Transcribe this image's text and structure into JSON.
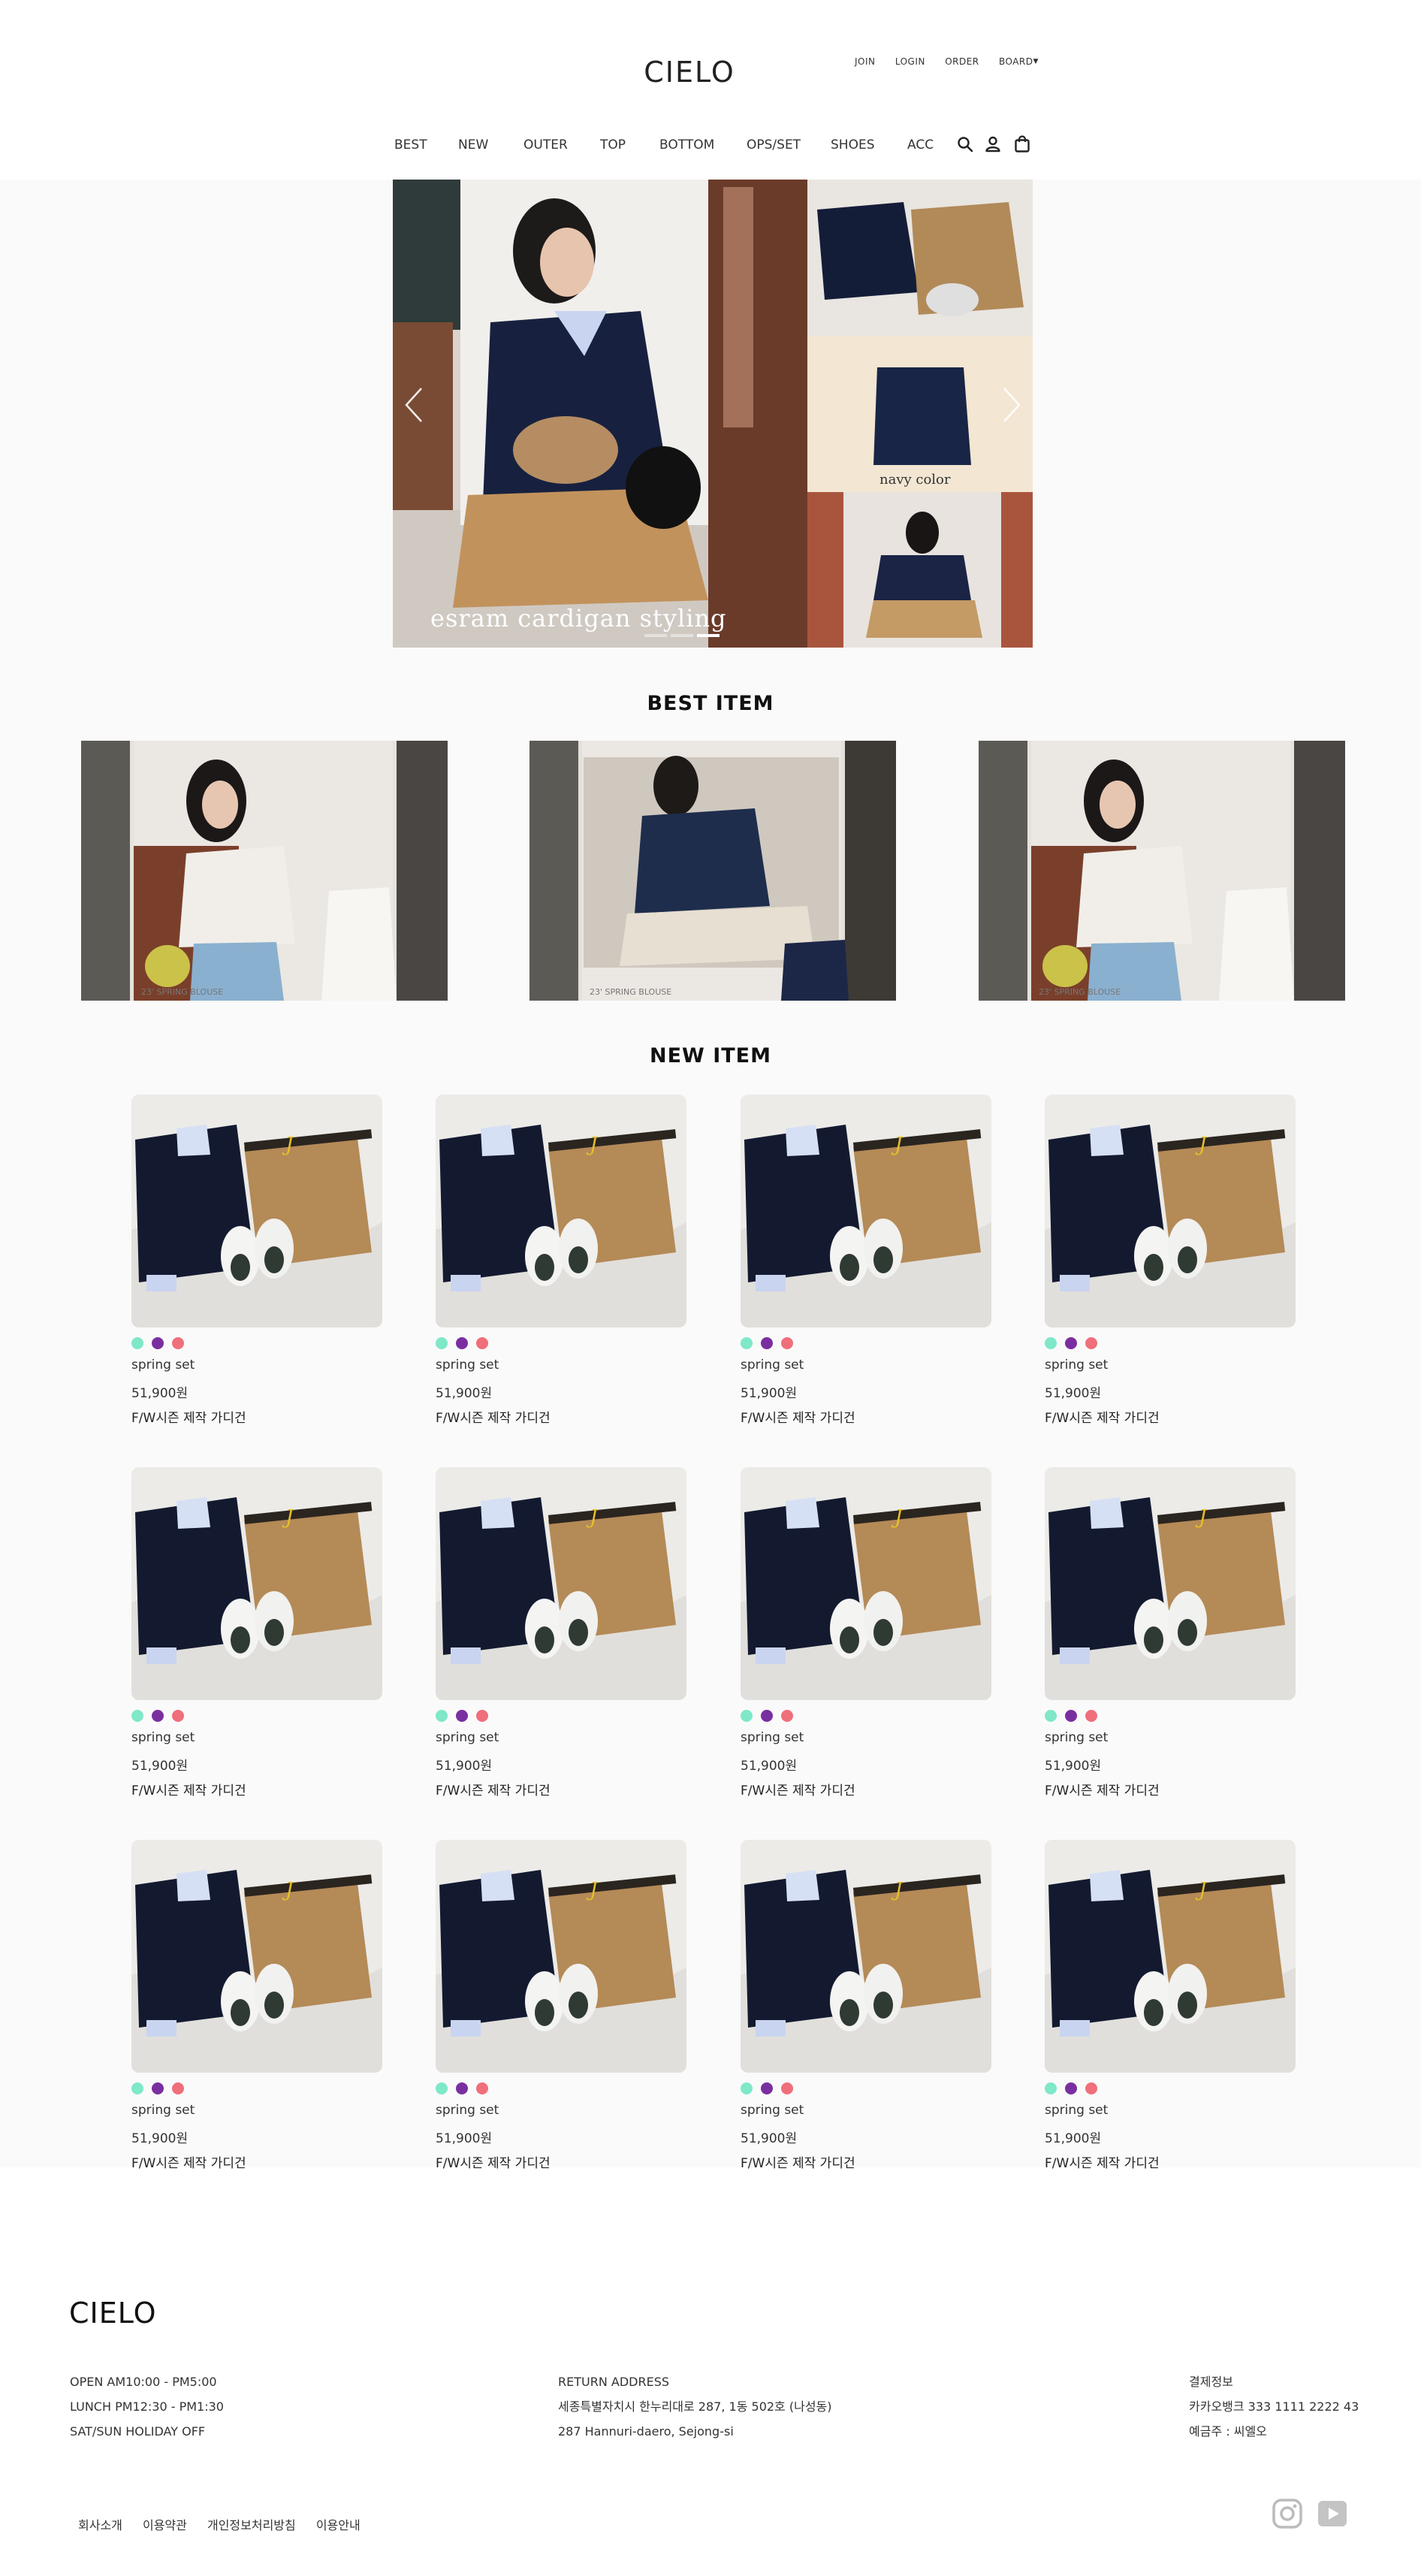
{
  "header": {
    "logo": "CIELO",
    "util_links": [
      "JOIN",
      "LOGIN",
      "ORDER",
      "BOARD"
    ]
  },
  "nav": {
    "items": [
      "BEST",
      "NEW",
      "OUTER",
      "TOP",
      "BOTTOM",
      "OPS/SET",
      "SHOES",
      "ACC"
    ],
    "icons": [
      "search-icon",
      "user-icon",
      "shopping-bag-icon"
    ]
  },
  "hero": {
    "caption": "esram cardigan styling",
    "sub_caption": "navy color",
    "slide_count": 3,
    "active_slide": 2
  },
  "best": {
    "title": "BEST ITEM",
    "items": [
      {
        "caption": "23' SPRING BLOUSE"
      },
      {
        "caption": "23' SPRING BLOUSE"
      },
      {
        "caption": "23' SPRING BLOUSE"
      }
    ]
  },
  "new": {
    "title": "NEW ITEM",
    "swatch_colors": [
      "#7ee8c8",
      "#7a2fa0",
      "#ef6f7a"
    ],
    "items": [
      {
        "name": "spring set",
        "price": "51,900원",
        "desc": "F/W시즌 제작 가디건"
      },
      {
        "name": "spring set",
        "price": "51,900원",
        "desc": "F/W시즌 제작 가디건"
      },
      {
        "name": "spring set",
        "price": "51,900원",
        "desc": "F/W시즌 제작 가디건"
      },
      {
        "name": "spring set",
        "price": "51,900원",
        "desc": "F/W시즌 제작 가디건"
      },
      {
        "name": "spring set",
        "price": "51,900원",
        "desc": "F/W시즌 제작 가디건"
      },
      {
        "name": "spring set",
        "price": "51,900원",
        "desc": "F/W시즌 제작 가디건"
      },
      {
        "name": "spring set",
        "price": "51,900원",
        "desc": "F/W시즌 제작 가디건"
      },
      {
        "name": "spring set",
        "price": "51,900원",
        "desc": "F/W시즌 제작 가디건"
      },
      {
        "name": "spring set",
        "price": "51,900원",
        "desc": "F/W시즌 제작 가디건"
      },
      {
        "name": "spring set",
        "price": "51,900원",
        "desc": "F/W시즌 제작 가디건"
      },
      {
        "name": "spring set",
        "price": "51,900원",
        "desc": "F/W시즌 제작 가디건"
      },
      {
        "name": "spring set",
        "price": "51,900원",
        "desc": "F/W시즌 제작 가디건"
      }
    ]
  },
  "footer": {
    "logo": "CIELO",
    "hours": [
      "OPEN AM10:00 - PM5:00",
      "LUNCH PM12:30 - PM1:30",
      "SAT/SUN HOLIDAY OFF"
    ],
    "return": [
      "RETURN ADDRESS",
      "세종특별자치시 한누리대로 287, 1동 502호 (나성동)",
      "287 Hannuri-daero, Sejong-si"
    ],
    "payment": [
      "결제정보",
      "카카오뱅크 333 1111 2222 43",
      "예금주 : 씨엘오"
    ],
    "links": [
      "회사소개",
      "이용약관",
      "개인정보처리방침",
      "이용안내"
    ],
    "social_icons": [
      "instagram-icon",
      "youtube-icon"
    ]
  }
}
